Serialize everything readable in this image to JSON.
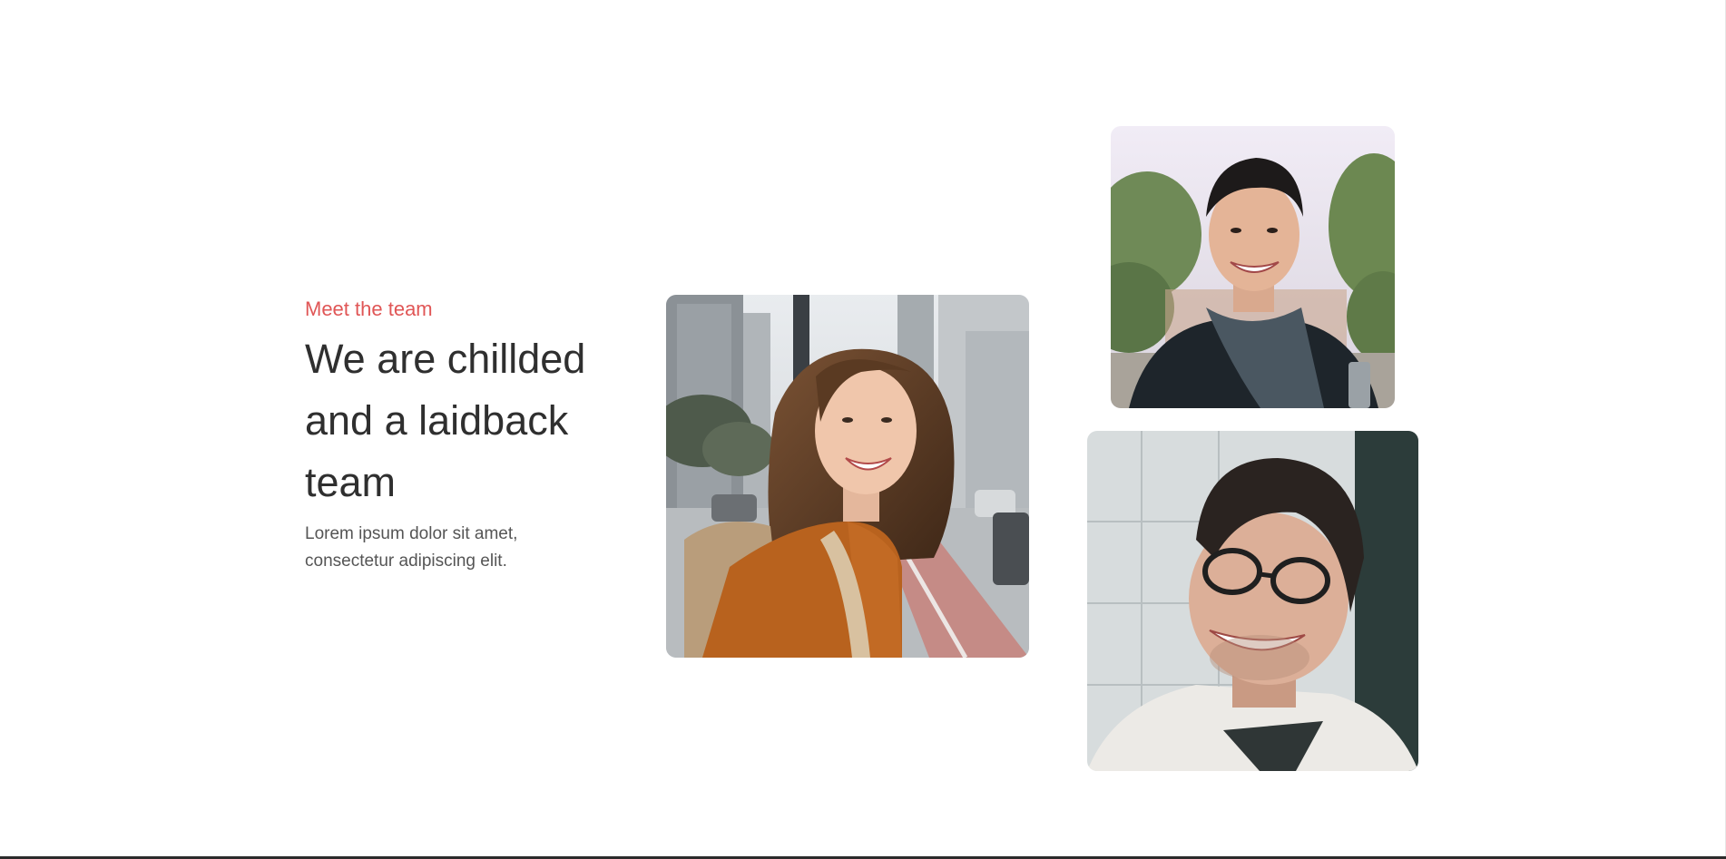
{
  "section": {
    "eyebrow": "Meet the team",
    "headline": "We are chillded and a laidback team",
    "body": "Lorem ipsum dolor sit amet, consectetur adipiscing elit."
  },
  "colors": {
    "accent": "#e05656",
    "heading": "#2f2f2f",
    "body_text": "#555555",
    "background": "#ffffff"
  },
  "photos": [
    {
      "name": "team-photo-woman",
      "subject": "smiling woman with backpack on city street"
    },
    {
      "name": "team-photo-man-scarf",
      "subject": "smiling man in dark coat and scarf outdoors"
    },
    {
      "name": "team-photo-man-glasses",
      "subject": "laughing man with glasses looking up"
    }
  ]
}
